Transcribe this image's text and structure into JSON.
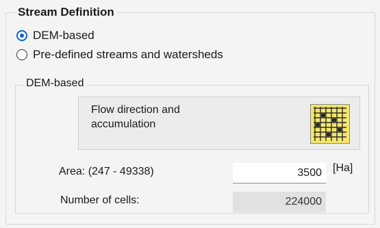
{
  "stream_definition": {
    "title": "Stream Definition",
    "options": [
      {
        "label": "DEM-based",
        "selected": true
      },
      {
        "label": "Pre-defined streams and watersheds",
        "selected": false
      }
    ]
  },
  "dem_based": {
    "title": "DEM-based",
    "flow_direction_label_line1": "Flow direction and",
    "flow_direction_label_line2": "accumulation",
    "flow_icon": "grid-raster-icon",
    "area_label": "Area: (247 - 49338)",
    "area_value": "3500",
    "area_unit": "[Ha]",
    "cells_label": "Number of cells:",
    "cells_value": "224000"
  },
  "colors": {
    "accent": "#0a64c8",
    "icon_fill": "#f3e66a"
  }
}
